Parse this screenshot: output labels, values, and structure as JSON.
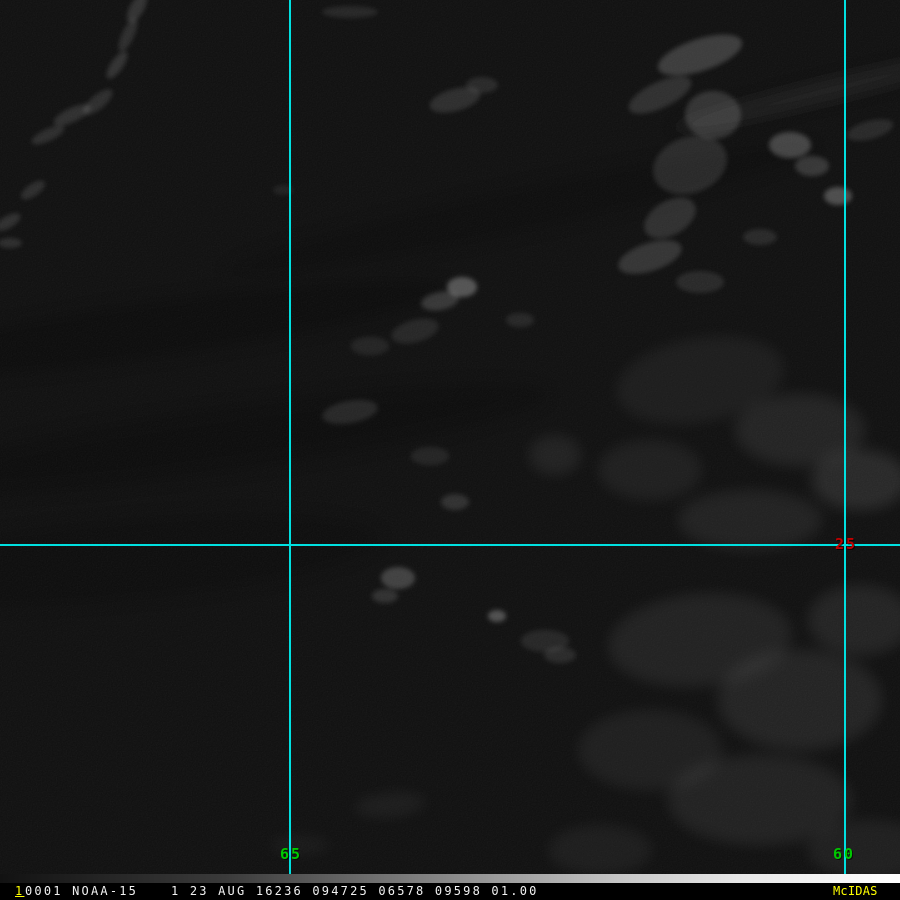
{
  "colors": {
    "grid_line": "#00e0e0",
    "longitude_label": "#00c800",
    "latitude_label": "#c00000",
    "status_text": "#f2f2f2",
    "status_accent": "#ffff00",
    "status_bg": "#000000",
    "image_background": "#0a0a0a"
  },
  "grid": {
    "longitude_labels": [
      {
        "text": "65"
      },
      {
        "text": "60"
      }
    ],
    "latitude_labels": [
      {
        "text": "25"
      }
    ]
  },
  "status_bar": {
    "frame_number": "1",
    "dataset_label": "0001 NOAA-15",
    "image_info": "1 23 AUG 16236 094725 06578 09598 01.00",
    "brand": "McIDAS"
  }
}
